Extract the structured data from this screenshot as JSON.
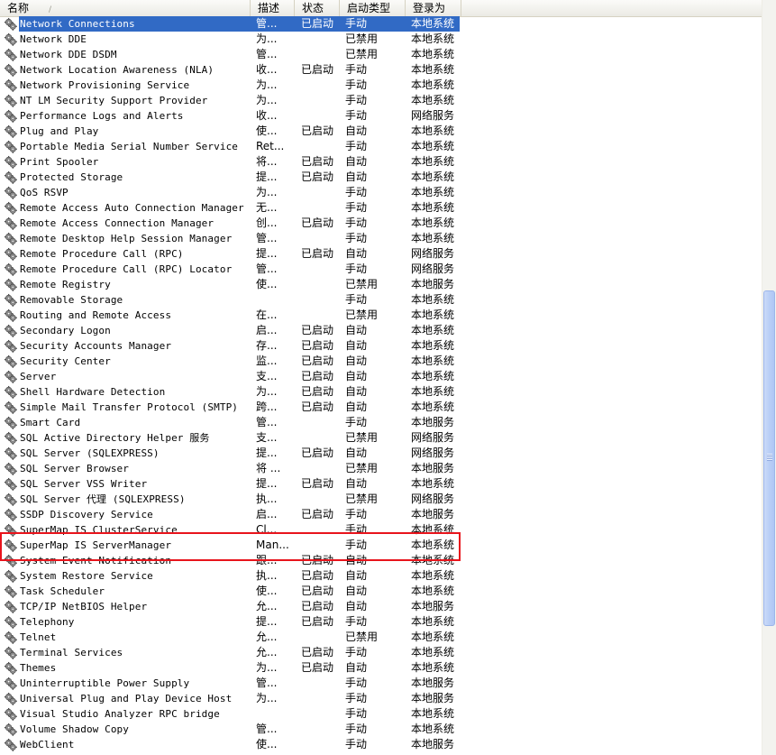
{
  "columns": {
    "name": "名称",
    "sort_indicator": "/",
    "description": "描述",
    "status": "状态",
    "startup_type": "启动类型",
    "logon_as": "登录为"
  },
  "rows": [
    {
      "name": "Network Connections",
      "description": "管...",
      "status": "已启动",
      "startup": "手动",
      "logon": "本地系统",
      "selected": true
    },
    {
      "name": "Network DDE",
      "description": "为...",
      "status": "",
      "startup": "已禁用",
      "logon": "本地系统"
    },
    {
      "name": "Network DDE DSDM",
      "description": "管...",
      "status": "",
      "startup": "已禁用",
      "logon": "本地系统"
    },
    {
      "name": "Network Location Awareness (NLA)",
      "description": "收...",
      "status": "已启动",
      "startup": "手动",
      "logon": "本地系统"
    },
    {
      "name": "Network Provisioning Service",
      "description": "为...",
      "status": "",
      "startup": "手动",
      "logon": "本地系统"
    },
    {
      "name": "NT LM Security Support Provider",
      "description": "为...",
      "status": "",
      "startup": "手动",
      "logon": "本地系统"
    },
    {
      "name": "Performance Logs and Alerts",
      "description": "收...",
      "status": "",
      "startup": "手动",
      "logon": "网络服务"
    },
    {
      "name": "Plug and Play",
      "description": "使...",
      "status": "已启动",
      "startup": "自动",
      "logon": "本地系统"
    },
    {
      "name": "Portable Media Serial Number Service",
      "description": "Ret...",
      "status": "",
      "startup": "手动",
      "logon": "本地系统"
    },
    {
      "name": "Print Spooler",
      "description": "将...",
      "status": "已启动",
      "startup": "自动",
      "logon": "本地系统"
    },
    {
      "name": "Protected Storage",
      "description": "提...",
      "status": "已启动",
      "startup": "自动",
      "logon": "本地系统"
    },
    {
      "name": "QoS RSVP",
      "description": "为...",
      "status": "",
      "startup": "手动",
      "logon": "本地系统"
    },
    {
      "name": "Remote Access Auto Connection Manager",
      "description": "无...",
      "status": "",
      "startup": "手动",
      "logon": "本地系统"
    },
    {
      "name": "Remote Access Connection Manager",
      "description": "创...",
      "status": "已启动",
      "startup": "手动",
      "logon": "本地系统"
    },
    {
      "name": "Remote Desktop Help Session Manager",
      "description": "管...",
      "status": "",
      "startup": "手动",
      "logon": "本地系统"
    },
    {
      "name": "Remote Procedure Call (RPC)",
      "description": "提...",
      "status": "已启动",
      "startup": "自动",
      "logon": "网络服务"
    },
    {
      "name": "Remote Procedure Call (RPC) Locator",
      "description": "管...",
      "status": "",
      "startup": "手动",
      "logon": "网络服务"
    },
    {
      "name": "Remote Registry",
      "description": "使...",
      "status": "",
      "startup": "已禁用",
      "logon": "本地服务"
    },
    {
      "name": "Removable Storage",
      "description": "",
      "status": "",
      "startup": "手动",
      "logon": "本地系统"
    },
    {
      "name": "Routing and Remote Access",
      "description": "在...",
      "status": "",
      "startup": "已禁用",
      "logon": "本地系统"
    },
    {
      "name": "Secondary Logon",
      "description": "启...",
      "status": "已启动",
      "startup": "自动",
      "logon": "本地系统"
    },
    {
      "name": "Security Accounts Manager",
      "description": "存...",
      "status": "已启动",
      "startup": "自动",
      "logon": "本地系统"
    },
    {
      "name": "Security Center",
      "description": "监...",
      "status": "已启动",
      "startup": "自动",
      "logon": "本地系统"
    },
    {
      "name": "Server",
      "description": "支...",
      "status": "已启动",
      "startup": "自动",
      "logon": "本地系统"
    },
    {
      "name": "Shell Hardware Detection",
      "description": "为...",
      "status": "已启动",
      "startup": "自动",
      "logon": "本地系统"
    },
    {
      "name": "Simple Mail Transfer Protocol (SMTP)",
      "description": "跨...",
      "status": "已启动",
      "startup": "自动",
      "logon": "本地系统"
    },
    {
      "name": "Smart Card",
      "description": "管...",
      "status": "",
      "startup": "手动",
      "logon": "本地服务"
    },
    {
      "name": "SQL Active Directory Helper 服务",
      "description": "支...",
      "status": "",
      "startup": "已禁用",
      "logon": "网络服务"
    },
    {
      "name": "SQL Server (SQLEXPRESS)",
      "description": "提...",
      "status": "已启动",
      "startup": "自动",
      "logon": "网络服务"
    },
    {
      "name": "SQL Server Browser",
      "description": "将 ...",
      "status": "",
      "startup": "已禁用",
      "logon": "本地服务"
    },
    {
      "name": "SQL Server VSS Writer",
      "description": "提...",
      "status": "已启动",
      "startup": "自动",
      "logon": "本地系统"
    },
    {
      "name": "SQL Server 代理 (SQLEXPRESS)",
      "description": "执...",
      "status": "",
      "startup": "已禁用",
      "logon": "网络服务"
    },
    {
      "name": "SSDP Discovery Service",
      "description": "启...",
      "status": "已启动",
      "startup": "手动",
      "logon": "本地服务"
    },
    {
      "name": "SuperMap IS ClusterService",
      "description": "Cl...",
      "status": "",
      "startup": "手动",
      "logon": "本地系统"
    },
    {
      "name": "SuperMap IS ServerManager",
      "description": "Man...",
      "status": "",
      "startup": "手动",
      "logon": "本地系统"
    },
    {
      "name": "System Event Notification",
      "description": "跟...",
      "status": "已启动",
      "startup": "自动",
      "logon": "本地系统"
    },
    {
      "name": "System Restore Service",
      "description": "执...",
      "status": "已启动",
      "startup": "自动",
      "logon": "本地系统"
    },
    {
      "name": "Task Scheduler",
      "description": "使...",
      "status": "已启动",
      "startup": "自动",
      "logon": "本地系统"
    },
    {
      "name": "TCP/IP NetBIOS Helper",
      "description": "允...",
      "status": "已启动",
      "startup": "自动",
      "logon": "本地服务"
    },
    {
      "name": "Telephony",
      "description": "提...",
      "status": "已启动",
      "startup": "手动",
      "logon": "本地系统"
    },
    {
      "name": "Telnet",
      "description": "允...",
      "status": "",
      "startup": "已禁用",
      "logon": "本地系统"
    },
    {
      "name": "Terminal Services",
      "description": "允...",
      "status": "已启动",
      "startup": "手动",
      "logon": "本地系统"
    },
    {
      "name": "Themes",
      "description": "为...",
      "status": "已启动",
      "startup": "自动",
      "logon": "本地系统"
    },
    {
      "name": "Uninterruptible Power Supply",
      "description": "管...",
      "status": "",
      "startup": "手动",
      "logon": "本地服务"
    },
    {
      "name": "Universal Plug and Play Device Host",
      "description": "为...",
      "status": "",
      "startup": "手动",
      "logon": "本地服务"
    },
    {
      "name": "Visual Studio Analyzer RPC bridge",
      "description": "",
      "status": "",
      "startup": "手动",
      "logon": "本地系统"
    },
    {
      "name": "Volume Shadow Copy",
      "description": "管...",
      "status": "",
      "startup": "手动",
      "logon": "本地系统"
    },
    {
      "name": "WebClient",
      "description": "使...",
      "status": "",
      "startup": "手动",
      "logon": "本地服务"
    }
  ],
  "colors": {
    "selection": "#316ac5",
    "highlight_box": "#e8141c",
    "scroll_thumb": "#bacff6"
  },
  "icons": {
    "row_icon": "gear-icon"
  }
}
